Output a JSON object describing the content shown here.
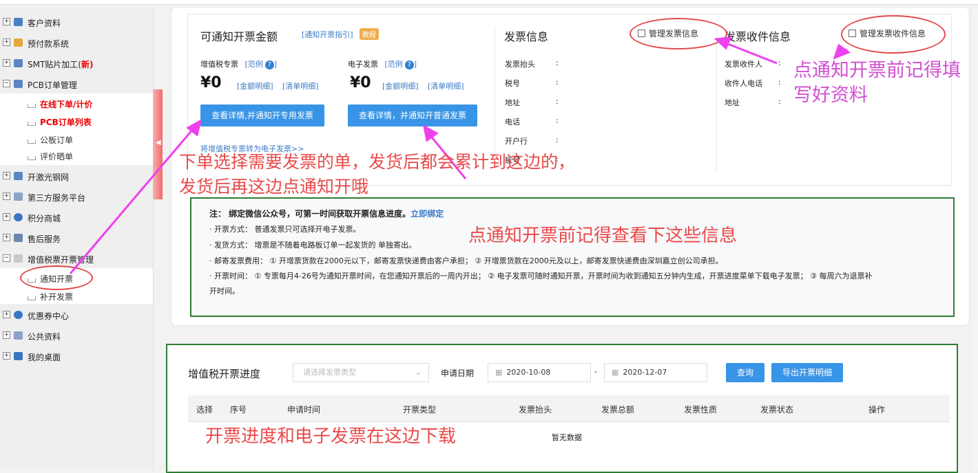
{
  "sidebar": {
    "items": [
      {
        "label": "客户资料",
        "red": ""
      },
      {
        "label": "预付款系统",
        "red": ""
      },
      {
        "label": "SMT贴片加工(",
        "red": "新)"
      },
      {
        "label": "PCB订单管理",
        "red": ""
      },
      {
        "label": "开激光钢网",
        "red": ""
      },
      {
        "label": "第三方服务平台",
        "red": ""
      },
      {
        "label": "积分商城",
        "red": ""
      },
      {
        "label": "售后服务",
        "red": ""
      },
      {
        "label": "增值税票开票管理",
        "red": ""
      },
      {
        "label": "优惠券中心",
        "red": ""
      },
      {
        "label": "公共资料",
        "red": ""
      },
      {
        "label": "我的桌面",
        "red": ""
      }
    ],
    "pcb_sub": [
      "在线下单/计价",
      "PCB订单列表",
      "公板订单",
      "评价晒单"
    ],
    "vat_sub": [
      "通知开票",
      "补开发票"
    ],
    "collapse_icon": "◀"
  },
  "invoice": {
    "title": "可通知开票金额",
    "guide_link": "[通知开票指引]",
    "tutorial_badge": "教程",
    "vat_label": "增值税专票",
    "e_label": "电子发票",
    "example_link": "[范例",
    "help": "?",
    "example_close": "]",
    "vat_amount": "¥0",
    "e_amount": "¥0",
    "amount_detail": "[金额明细]",
    "list_detail": "[清单明细]",
    "vat_button": "查看详情,并通知开专用发票",
    "e_button": "查看详情，并通知开普通发票",
    "convert_link": "将增值税专票转为电子发票>>"
  },
  "info": {
    "title": "发票信息",
    "manage": "管理发票信息",
    "fields": [
      "发票抬头",
      "税号",
      "地址",
      "电话",
      "开户行",
      "账号"
    ],
    "colon": ":"
  },
  "receiver": {
    "title": "发票收件信息",
    "manage": "管理发票收件信息",
    "fields": [
      "发票收件人",
      "收件人电话",
      "地址"
    ],
    "colon": ":"
  },
  "annotations": {
    "fill_info_1": "点通知开票前记得填",
    "fill_info_2": "写好资料",
    "order_1": "下单选择需要发票的单，发货后都会累计到这边的，",
    "order_2": "发货后再这边点通知开哦",
    "check_info": "点通知开票前记得查看下这些信息",
    "download": "开票进度和电子发票在这边下载"
  },
  "notes": {
    "title": "注：  绑定微信公众号，可第一时间获取开票信息进度。",
    "bind": "立即绑定",
    "l1": "· 开票方式：  普通发票只可选择开电子发票。",
    "l2": "· 发货方式：  增票是不随着电路板订单一起发货的 单独寄出。",
    "l3": "· 邮寄发票费用：  ① 开增票货款在2000元以下，邮寄发票快递费由客户承担；  ② 开增票货款在2000元及以上，邮寄发票快递费由深圳嘉立创公司承担。",
    "l4": "· 开票时间：  ① 专票每月4-26号为通知开票时间，在您通知开票后的一周内开出；  ② 电子发票可随时通知开票，开票时间为收到通知五分钟内生成，开票进度菜单下载电子发票；  ③ 每周六为退票补",
    "l5": "开时间。"
  },
  "progress": {
    "title": "增值税开票进度",
    "type_placeholder": "请选择发票类型",
    "date_label": "申请日期",
    "date_from": "2020-10-08",
    "date_sep": "-",
    "date_to": "2020-12-07",
    "query": "查询",
    "export": "导出开票明细",
    "columns": [
      "选择",
      "序号",
      "申请时间",
      "开票类型",
      "发票抬头",
      "发票总额",
      "发票性质",
      "发票状态",
      "操作"
    ],
    "empty": "暂无数据"
  },
  "close_icon": "✕"
}
